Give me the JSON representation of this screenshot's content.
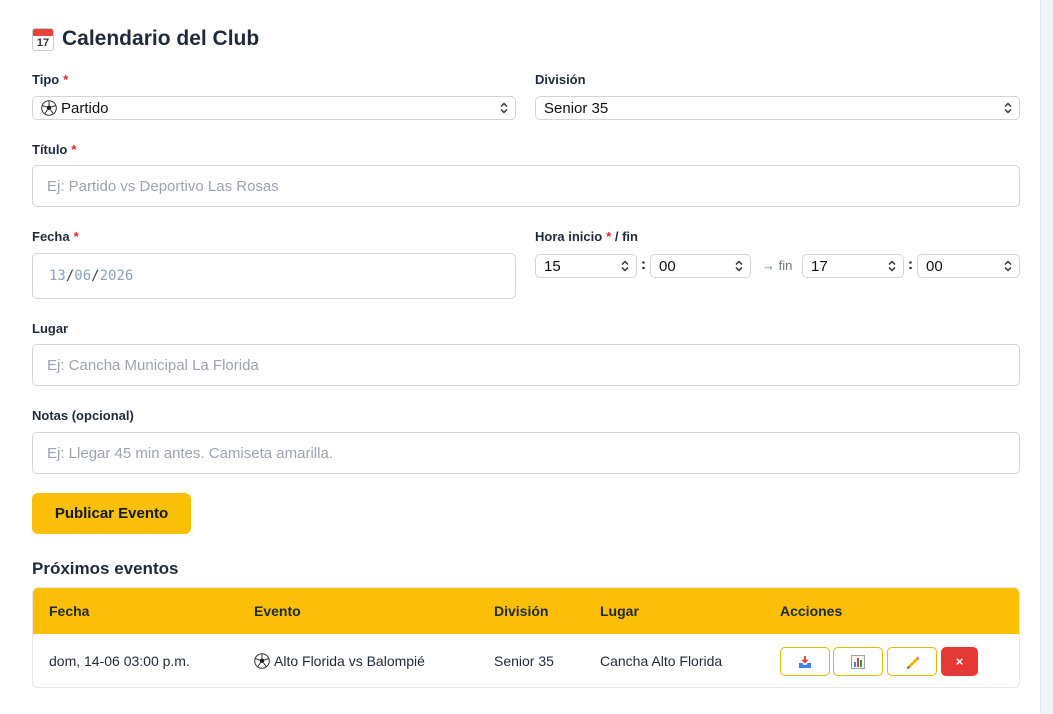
{
  "header": {
    "title": "Calendario del Club",
    "icon": "calendar-icon",
    "icon_day": "17"
  },
  "form": {
    "tipo": {
      "label": "Tipo",
      "value": "Partido",
      "icon": "soccer-ball-icon"
    },
    "division": {
      "label": "División",
      "value": "Senior 35"
    },
    "titulo": {
      "label": "Título",
      "placeholder": "Ej: Partido vs Deportivo Las Rosas"
    },
    "fecha": {
      "label": "Fecha",
      "day": "13",
      "month": "06",
      "year": "2026",
      "sep": "/"
    },
    "hora": {
      "label": "Hora inicio",
      "label_suffix": "/ fin",
      "start_hour": "15",
      "start_min": "00",
      "fin_label": "→ fin",
      "end_hour": "17",
      "end_min": "00",
      "colon": ":"
    },
    "lugar": {
      "label": "Lugar",
      "placeholder": "Ej: Cancha Municipal La Florida"
    },
    "notas": {
      "label": "Notas (opcional)",
      "placeholder": "Ej: Llegar 45 min antes. Camiseta amarilla."
    },
    "required_mark": "*",
    "submit_label": "Publicar Evento"
  },
  "events": {
    "title": "Próximos eventos",
    "columns": [
      "Fecha",
      "Evento",
      "División",
      "Lugar",
      "Acciones"
    ],
    "rows": [
      {
        "fecha": "dom, 14-06 03:00 p.m.",
        "evento": "Alto Florida vs Balompié",
        "division": "Senior 35",
        "lugar": "Cancha Alto Florida",
        "actions": [
          "inbox-icon",
          "bar-chart-icon",
          "pencil-icon",
          "close-icon"
        ],
        "delete_label": "×"
      }
    ]
  },
  "colors": {
    "accent": "#fbbf07",
    "danger": "#e53935",
    "required": "#dc2626"
  }
}
